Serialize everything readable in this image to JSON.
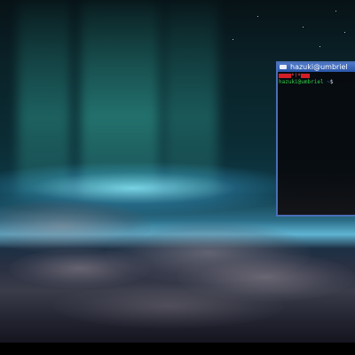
{
  "desktop": {
    "wallpaper": "aurora-over-earth-clouds"
  },
  "terminal": {
    "title": "hazuki@umbriel",
    "title_icon": "window-menu-icon",
    "status_marker": "*!*",
    "prompt_user": "hazuki@umbriel",
    "prompt_path": "~",
    "prompt_cmd": "$",
    "border_color": "#4a6fb6",
    "titlebar_color": "#3a66b8"
  }
}
